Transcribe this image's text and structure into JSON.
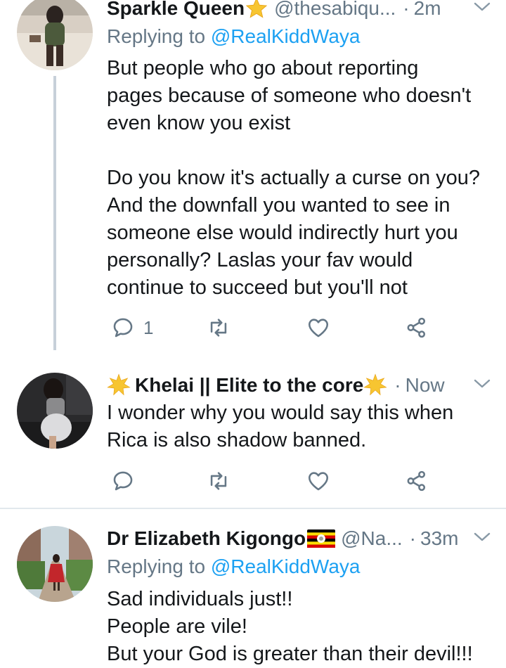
{
  "tweets": [
    {
      "name": "Sparkle Queen",
      "handle": "@thesabiqu...",
      "time": "2m",
      "reply_prefix": "Replying to ",
      "reply_mention": "@RealKiddWaya",
      "body": "But people who go about reporting\npages because of someone who doesn't\neven know you exist\n\nDo you know it's actually a curse on you?\nAnd the downfall you wanted to see in\nsomeone else would indirectly hurt you\npersonally? Laslas your fav would\ncontinue to succeed but you'll not",
      "reply_count": "1"
    },
    {
      "name": "Khelai || Elite to the core",
      "time": "Now",
      "body": "I wonder why you would say this when\nRica is also shadow banned."
    },
    {
      "name": "Dr Elizabeth Kigongo",
      "handle": "@Na...",
      "time": "33m",
      "reply_prefix": "Replying to ",
      "reply_mention": "@RealKiddWaya",
      "body": "Sad individuals just!!\nPeople are vile!\nBut your God is greater than their devil!!!"
    }
  ],
  "separator": "·",
  "icons": [
    "reply-icon",
    "retweet-icon",
    "like-icon",
    "share-icon",
    "star-icon",
    "uganda-flag-icon",
    "chevron-down-icon"
  ],
  "colors": {
    "link": "#1da1f2",
    "muted": "#657786",
    "text": "#14171a"
  }
}
